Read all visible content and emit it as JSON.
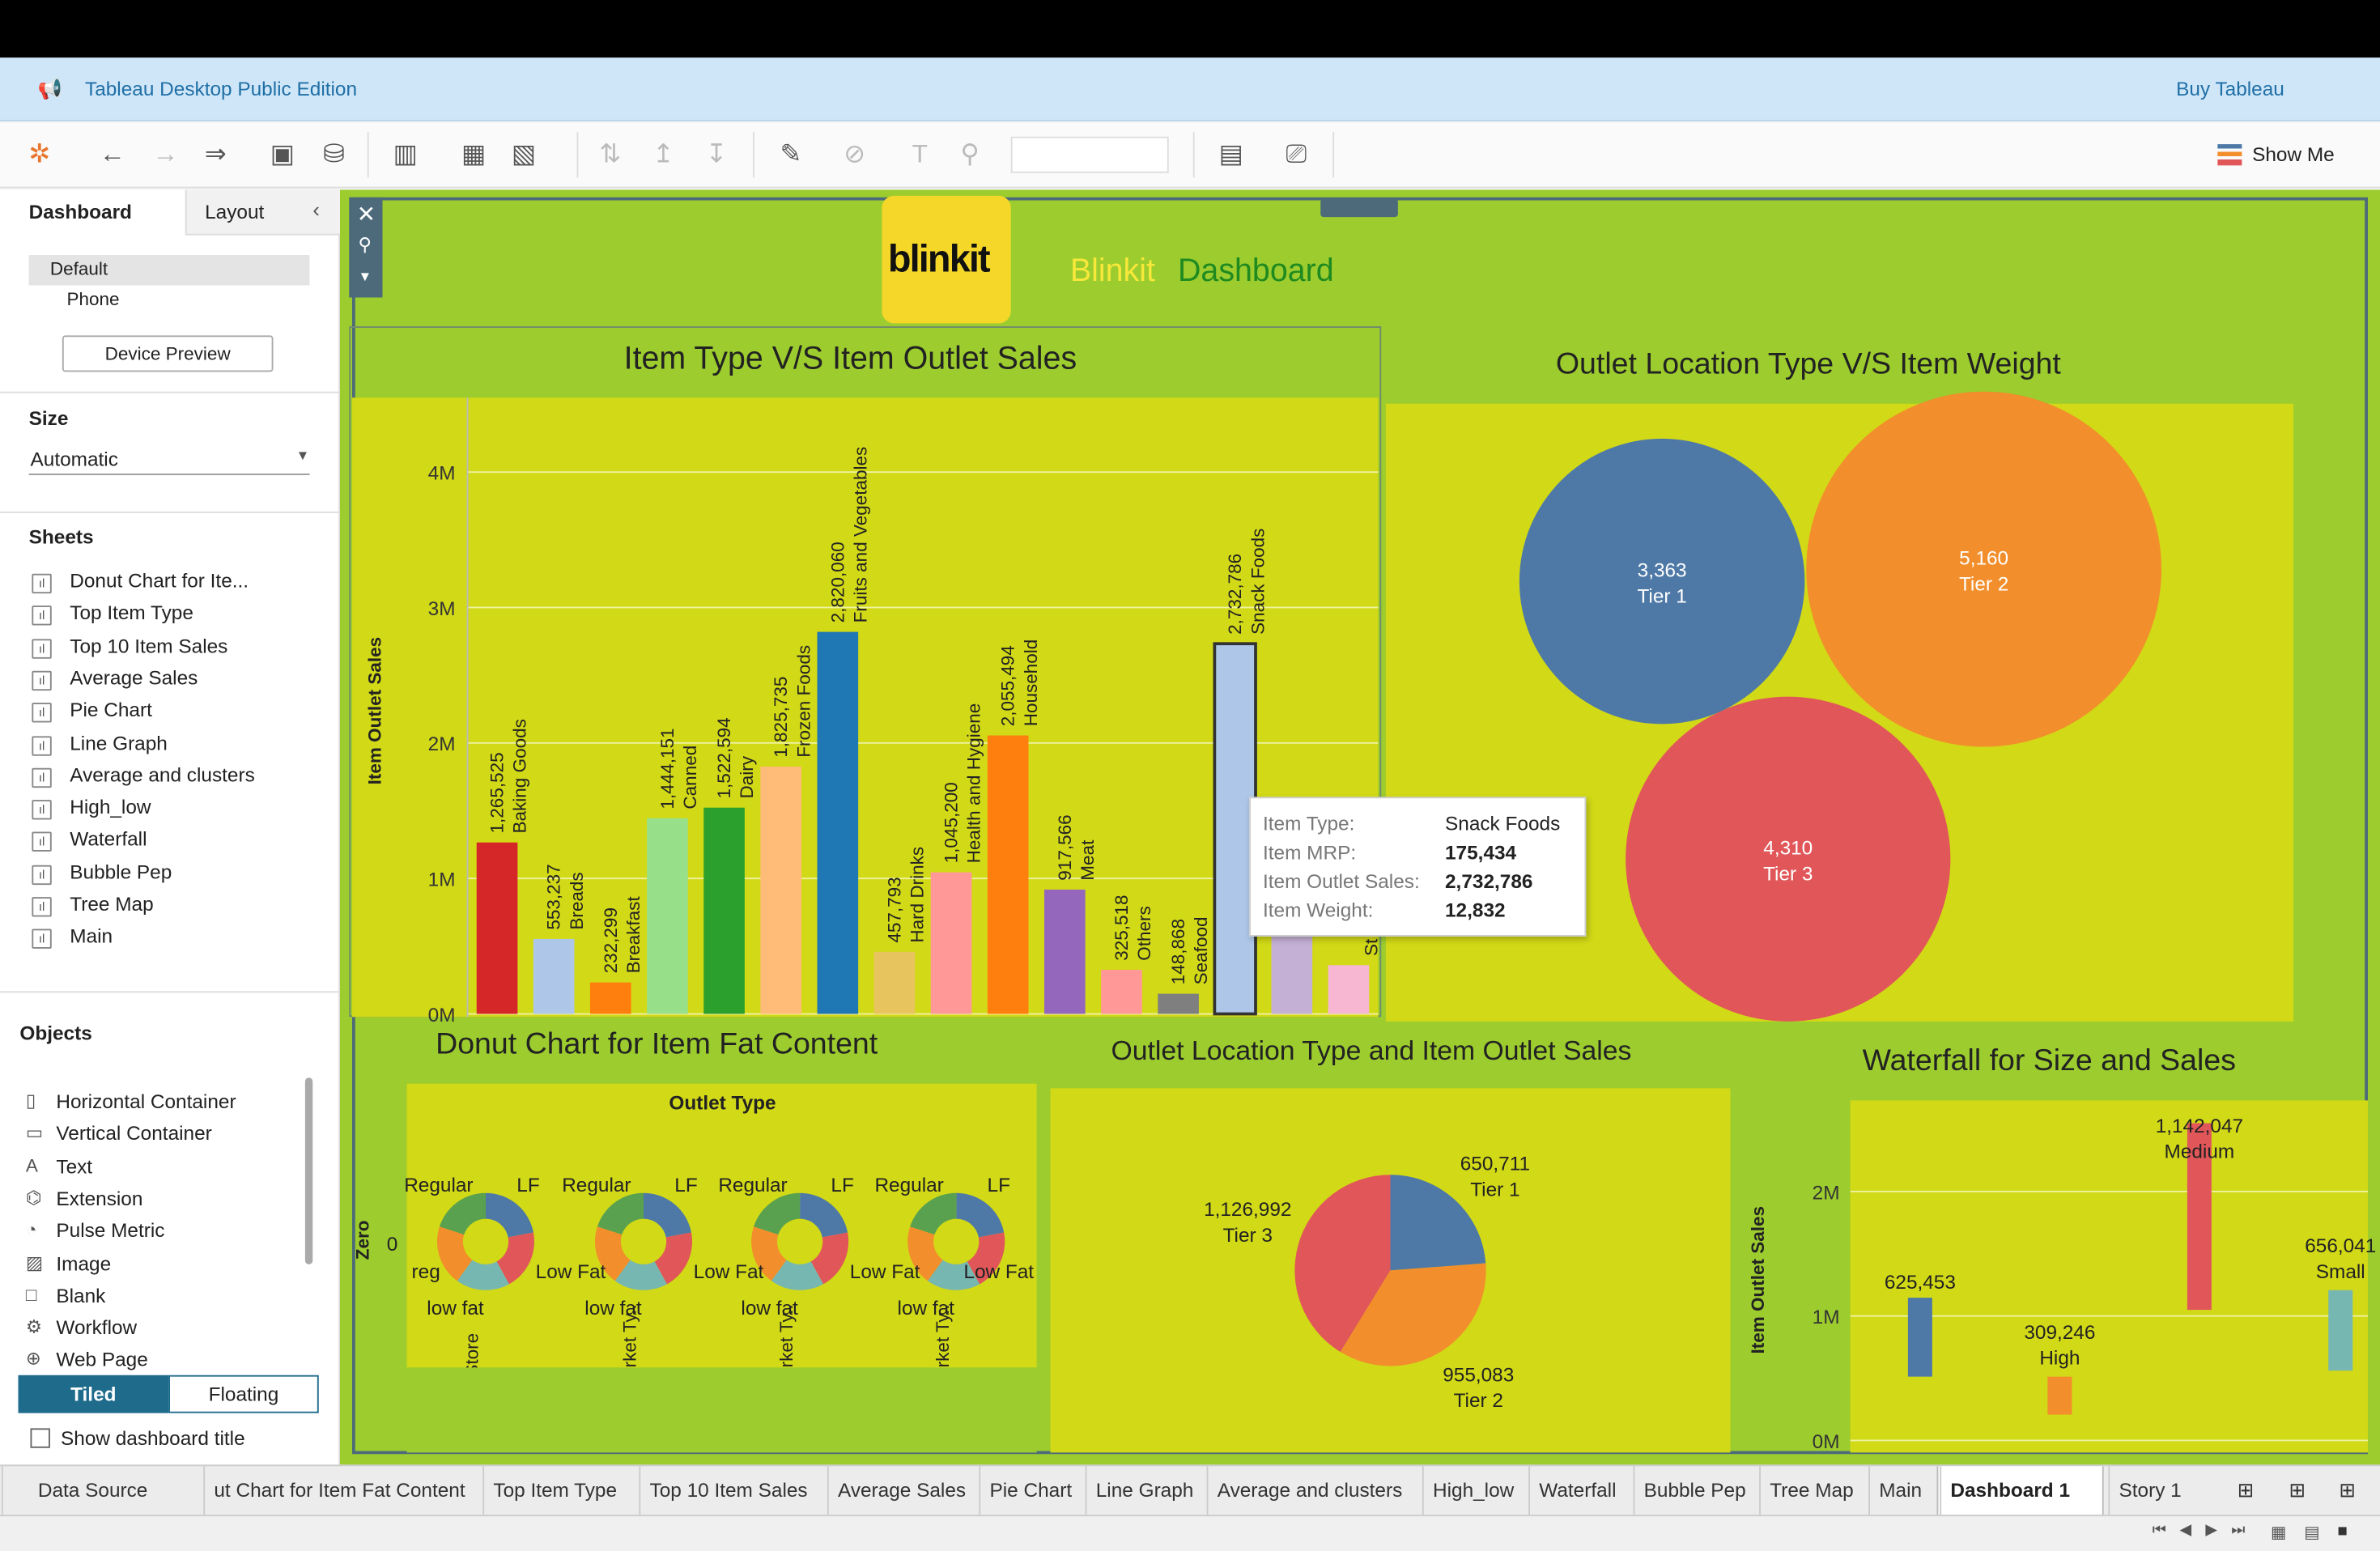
{
  "app": {
    "title": "Tableau Desktop Public Edition",
    "buy": "Buy Tableau",
    "show_me": "Show Me"
  },
  "sidebar": {
    "tab_dashboard": "Dashboard",
    "tab_layout": "Layout",
    "device_default": "Default",
    "device_phone": "Phone",
    "device_preview": "Device Preview",
    "size_label": "Size",
    "size_value": "Automatic",
    "sheets_label": "Sheets",
    "sheets": [
      "Donut Chart for Ite...",
      "Top Item Type",
      "Top 10 Item Sales",
      "Average Sales",
      "Pie Chart",
      "Line Graph",
      "Average and clusters",
      "High_low",
      "Waterfall",
      "Bubble Pep",
      "Tree Map",
      "Main"
    ],
    "objects_label": "Objects",
    "objects": [
      "Horizontal Container",
      "Vertical Container",
      "Text",
      "Extension",
      "Pulse Metric",
      "Image",
      "Blank",
      "Workflow",
      "Web Page"
    ],
    "tiled": "Tiled",
    "floating": "Floating",
    "show_title": "Show dashboard title"
  },
  "dashboard": {
    "logo": "blinkit",
    "title_a": "Blinkit",
    "title_b": "Dashboard"
  },
  "chart_data": [
    {
      "type": "bar",
      "title": "Item Type V/S Item Outlet Sales",
      "ylabel": "Item Outlet Sales",
      "ylim": [
        0,
        4500000
      ],
      "yticks": [
        "0M",
        "1M",
        "2M",
        "3M",
        "4M"
      ],
      "categories": [
        "Baking Goods",
        "Breads",
        "Breakfast",
        "Canned",
        "Dairy",
        "Frozen Foods",
        "Fruits and Vegetables",
        "Hard Drinks",
        "Health and Hygiene",
        "Household",
        "Meat",
        "Others",
        "Seafood",
        "Snack Foods",
        "",
        "St"
      ],
      "values": [
        1265525,
        553237,
        232299,
        1444151,
        1522594,
        1825735,
        2820060,
        457793,
        1045200,
        2055494,
        917566,
        325518,
        148868,
        2732786,
        650000,
        360000
      ],
      "labels": [
        "1,265,525",
        "553,237",
        "232,299",
        "1,444,151",
        "1,522,594",
        "1,825,735",
        "2,820,060",
        "457,793",
        "1,045,200",
        "2,055,494",
        "917,566",
        "325,518",
        "148,868",
        "2,732,786",
        "",
        ""
      ],
      "colors": [
        "#d62728",
        "#aec7e8",
        "#ff7f0e",
        "#98df8a",
        "#2ca02c",
        "#ffbb78",
        "#1f77b4",
        "#e8c45e",
        "#ff9896",
        "#ff7f0e",
        "#9467bd",
        "#ff9896",
        "#7f7f7f",
        "#aec7e8",
        "#c5b0d5",
        "#f7b6d2"
      ]
    },
    {
      "type": "bubble",
      "title": "Outlet Location Type V/S Item Weight",
      "values": [
        {
          "label": "Tier 1",
          "value": "3,363",
          "color": "#4e79a7"
        },
        {
          "label": "Tier 2",
          "value": "5,160",
          "color": "#f28e2b"
        },
        {
          "label": "Tier 3",
          "value": "4,310",
          "color": "#e15759"
        }
      ]
    },
    {
      "type": "pie",
      "title": "Donut Chart for Item Fat Content",
      "header": "Outlet Type",
      "row_label": "Zero",
      "row_value": "0",
      "labels_top": [
        "Regular",
        "LF"
      ],
      "labels_bottom": [
        "reg",
        "Low Fat",
        "low fat"
      ],
      "categories": [
        "Grocery Store",
        "Superma rket Ty..",
        "Superma rket Ty..",
        "Superma rket Ty.."
      ]
    },
    {
      "type": "pie",
      "title": "Outlet Location Type and Item Outlet Sales",
      "values": [
        {
          "label": "Tier 1",
          "value": "650,711",
          "v": 650711,
          "color": "#4e79a7"
        },
        {
          "label": "Tier 2",
          "value": "955,083",
          "v": 955083,
          "color": "#f28e2b"
        },
        {
          "label": "Tier 3",
          "value": "1,126,992",
          "v": 1126992,
          "color": "#e15759"
        }
      ]
    },
    {
      "type": "bar",
      "title": "Waterfall for Size and Sales",
      "ylabel": "Item Outlet Sales",
      "yticks": [
        "0M",
        "1M",
        "2M"
      ],
      "values": [
        {
          "label": "",
          "value": "625,453"
        },
        {
          "label": "High",
          "value": "309,246"
        },
        {
          "label": "Medium",
          "value": "1,142,047"
        },
        {
          "label": "Small",
          "value": "656,041"
        }
      ]
    }
  ],
  "tooltip": {
    "k1": "Item Type:",
    "v1": "Snack Foods",
    "k2": "Item MRP:",
    "v2": "175,434",
    "k3": "Item Outlet Sales:",
    "v3": "2,732,786",
    "k4": "Item Weight:",
    "v4": "12,832"
  },
  "tabs": [
    "Data Source",
    "ut Chart for Item Fat Content",
    "Top Item Type",
    "Top 10 Item Sales",
    "Average Sales",
    "Pie Chart",
    "Line Graph",
    "Average and clusters",
    "High_low",
    "Waterfall",
    "Bubble Pep",
    "Tree Map",
    "Main",
    "Dashboard 1",
    "Story 1"
  ]
}
